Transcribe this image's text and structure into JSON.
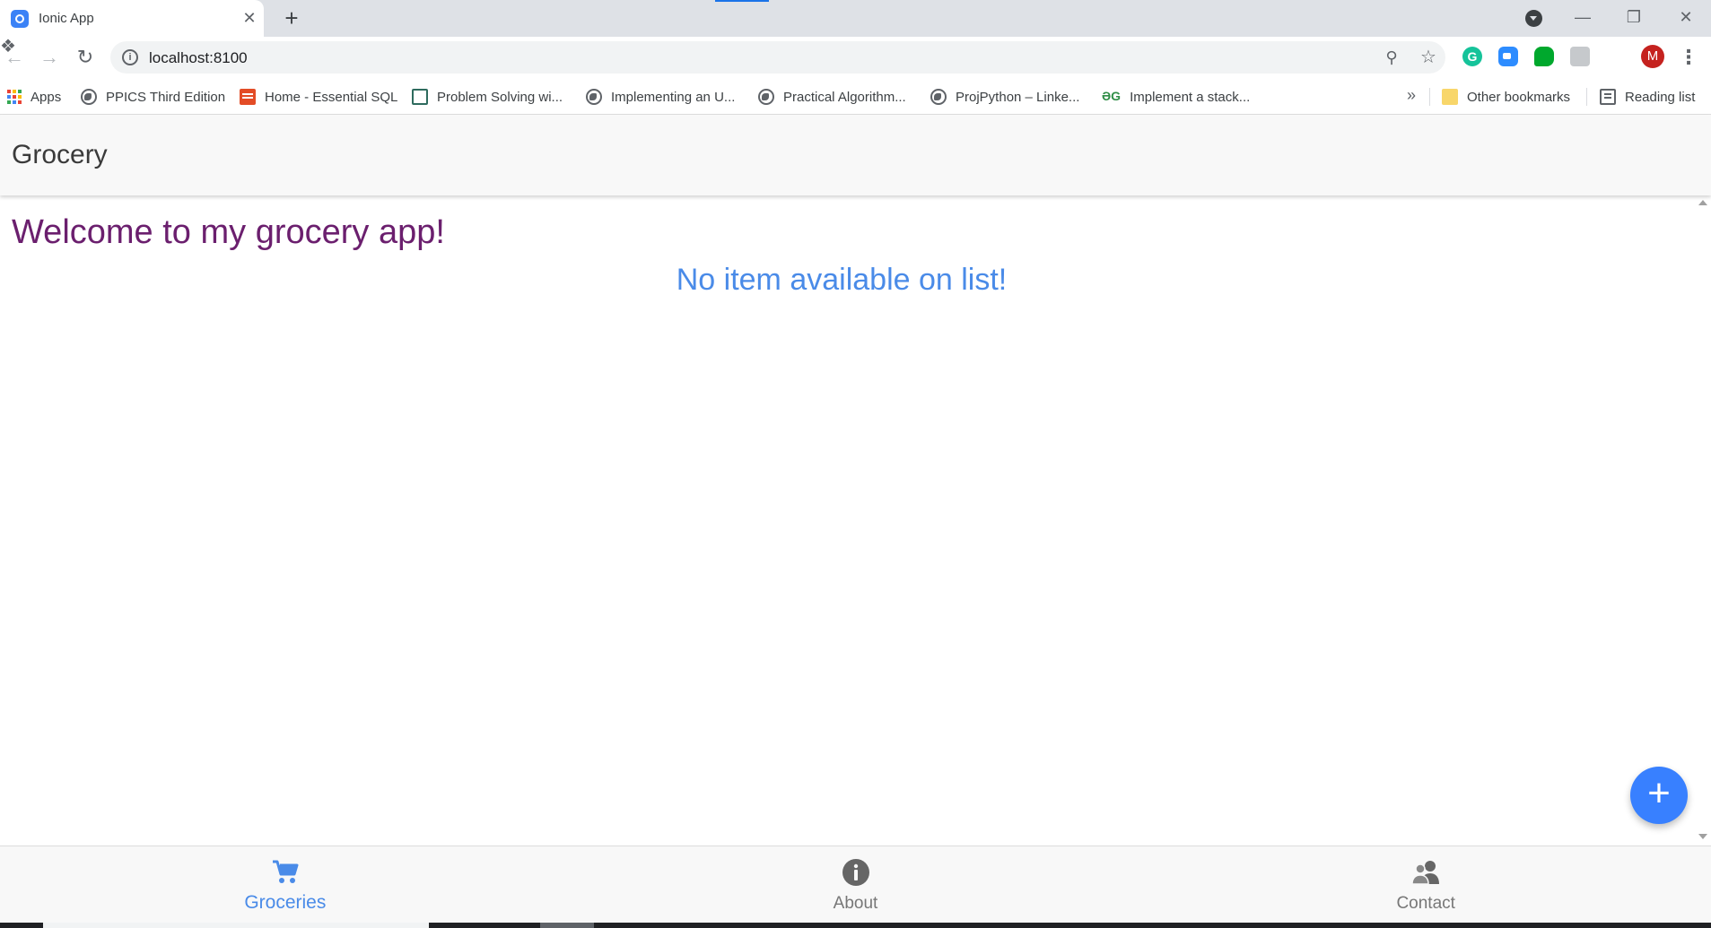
{
  "browser": {
    "tab_title": "Ionic App",
    "tab_close": "✕",
    "new_tab": "+",
    "url": "localhost:8100",
    "avatar_letter": "M",
    "grammarly_letter": "G",
    "window_min": "—",
    "window_max": "❐",
    "window_close": "✕",
    "bookmarks_more": "»",
    "bookmarks": [
      {
        "label": "Apps",
        "icon": "apps-icon"
      },
      {
        "label": "PPICS Third Edition",
        "icon": "globe-icon"
      },
      {
        "label": "Home - Essential SQL",
        "icon": "essential-sql-icon"
      },
      {
        "label": "Problem Solving wi...",
        "icon": "problem-solving-icon"
      },
      {
        "label": "Implementing an U...",
        "icon": "globe-icon"
      },
      {
        "label": "Practical Algorithm...",
        "icon": "globe-icon"
      },
      {
        "label": "ProjPython – Linke...",
        "icon": "globe-icon"
      },
      {
        "label": "Implement a stack...",
        "icon": "geeksforgeeks-icon"
      },
      {
        "label": "Other bookmarks",
        "icon": "folder-icon"
      },
      {
        "label": "Reading list",
        "icon": "reading-list-icon"
      }
    ],
    "gfg_glyph": "ƏG"
  },
  "app": {
    "header_title": "Grocery",
    "welcome_text": "Welcome to my grocery app!",
    "empty_message": "No item available on list!",
    "fab_label": "+",
    "colors": {
      "welcome": "#6b1f6e",
      "empty_message": "#4a8be8",
      "primary": "#3880ff",
      "tab_inactive": "#777777"
    },
    "tabs": [
      {
        "label": "Groceries",
        "icon": "cart-icon",
        "active": true
      },
      {
        "label": "About",
        "icon": "info-icon",
        "active": false
      },
      {
        "label": "Contact",
        "icon": "people-icon",
        "active": false
      }
    ]
  }
}
